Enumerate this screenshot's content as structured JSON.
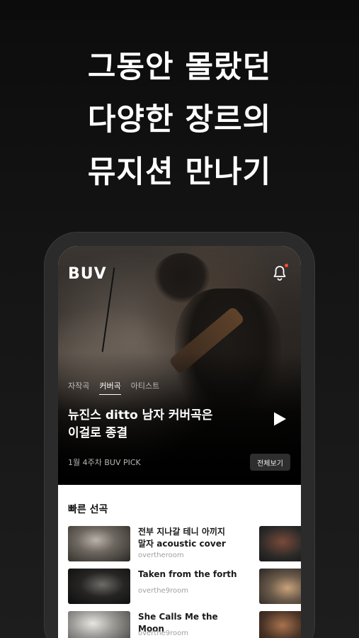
{
  "headline": [
    "그동안 몰랐던",
    "다양한 장르의",
    "뮤지션 만나기"
  ],
  "app": {
    "logo": "BUV",
    "tabs": [
      "자작곡",
      "커버곡",
      "아티스트"
    ],
    "active_tab": "커버곡",
    "hero_title_lines": [
      "뉴진스 ditto 남자 커버곡은",
      "이걸로 종결"
    ],
    "pick_label": "1월 4주차 BUV PICK",
    "view_all": "전체보기",
    "quick_section_title": "빠른 선곡",
    "songs": [
      {
        "title_lines": [
          "전부 지나갈 테니 아끼지",
          "말자 acoustic cover"
        ],
        "artist": "overtheroom"
      },
      {
        "title_lines": [
          "Taken from the forth"
        ],
        "artist": "overthe9room"
      },
      {
        "title_lines": [
          "She Calls Me the Moon"
        ],
        "artist": "overthe9room"
      }
    ]
  },
  "colors": {
    "accent_dot": "#ff4a3a",
    "background": "#121212",
    "phone_frame": "#2b2b2b"
  },
  "icons": [
    "bell-icon",
    "play-icon"
  ]
}
